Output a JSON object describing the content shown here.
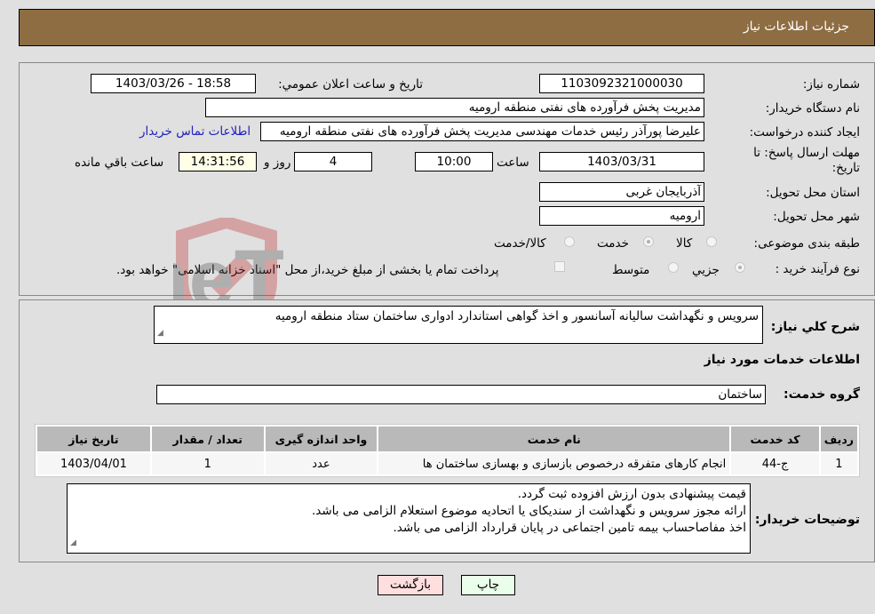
{
  "header": {
    "title": "جزئیات اطلاعات نیاز"
  },
  "form": {
    "need_number": {
      "label": "شماره نیاز:",
      "value": "1103092321000030"
    },
    "announce_datetime": {
      "label": "تاریخ و ساعت اعلان عمومي:",
      "value": "1403/03/26 - 18:58"
    },
    "buyer_org": {
      "label": "نام دستگاه خریدار:",
      "value": "مدیریت پخش فرآورده های نفتی منطقه ارومیه"
    },
    "requester": {
      "label": "ایجاد کننده درخواست:",
      "value": "علیرضا پورآذر رئیس خدمات مهندسی مدیریت پخش فرآورده های نفتی منطقه ارومیه"
    },
    "buyer_contact_link": "اطلاعات تماس خریدار",
    "deadline": {
      "label": "مهلت ارسال پاسخ: تا تاریخ:",
      "date": "1403/03/31",
      "time_label": "ساعت",
      "time": "10:00",
      "days": "4",
      "days_label": "روز و",
      "remaining": "14:31:56",
      "remaining_label": "ساعت باقي مانده"
    },
    "province": {
      "label": "استان محل تحویل:",
      "value": "آذربایجان غربی"
    },
    "city": {
      "label": "شهر محل تحویل:",
      "value": "ارومیه"
    },
    "category": {
      "label": "طبقه بندی موضوعی:",
      "options": [
        "کالا",
        "خدمت",
        "کالا/خدمت"
      ],
      "selected": "خدمت"
    },
    "purchase_type": {
      "label": "نوع فرآیند خرید :",
      "options": [
        "جزيي",
        "متوسط"
      ],
      "selected": "جزيي",
      "treasury_note": "پرداخت تمام یا بخشی از مبلغ خرید،از محل \"اسناد خزانه اسلامی\" خواهد بود."
    }
  },
  "description": {
    "label": "شرح كلي نياز:",
    "value": "سرویس و نگهداشت سالیانه آسانسور و اخذ گواهی استاندارد ادواری ساختمان ستاد منطقه ارومیه"
  },
  "services_section": {
    "title": "اطلاعات خدمات مورد نیاز",
    "group_label": "گروه خدمت:",
    "group_value": "ساختمان",
    "table": {
      "headers": [
        "ردیف",
        "کد خدمت",
        "نام خدمت",
        "واحد اندازه گیری",
        "تعداد / مقدار",
        "تاریخ نیاز"
      ],
      "rows": [
        [
          "1",
          "ج-44",
          "انجام کارهای متفرقه درخصوص بازسازی و بهسازی ساختمان ها",
          "عدد",
          "1",
          "1403/04/01"
        ]
      ]
    }
  },
  "buyer_notes": {
    "label": "توضیحات خریدار:",
    "lines": [
      "قیمت پیشنهادی بدون ارزش افزوده ثبت گردد.",
      "ارائه مجوز سرویس و نگهداشت از سندیکای یا اتحادیه موضوع استعلام الزامی می باشد.",
      "اخذ مفاصاحساب بیمه تامین اجتماعی در پایان قرارداد الزامی می باشد."
    ]
  },
  "buttons": {
    "print": "چاپ",
    "back": "بازگشت"
  },
  "watermark": {
    "text": "AriaTender.neT"
  },
  "colors": {
    "header_bg": "#8e6d42",
    "link": "#2020c0",
    "print_btn_bg": "#eaffea",
    "back_btn_bg": "#ffdede"
  }
}
